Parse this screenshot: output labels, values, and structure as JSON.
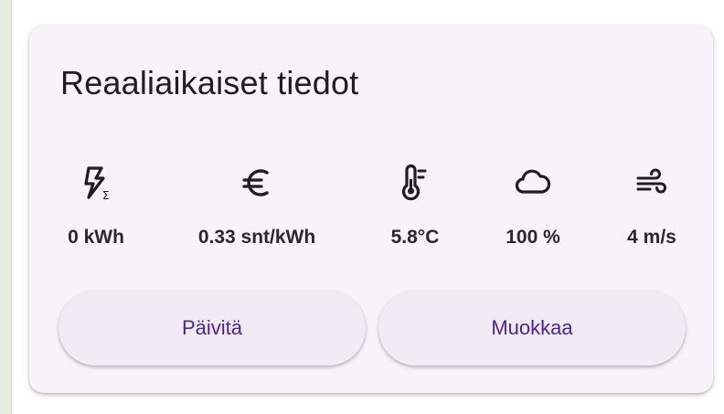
{
  "card": {
    "title": "Reaaliaikaiset tiedot"
  },
  "metrics": [
    {
      "icon": "lightning-sum-icon",
      "value": "0 kWh"
    },
    {
      "icon": "euro-icon",
      "value": "0.33 snt/kWh"
    },
    {
      "icon": "thermometer-icon",
      "value": "5.8°C"
    },
    {
      "icon": "cloud-icon",
      "value": "100 %"
    },
    {
      "icon": "wind-icon",
      "value": "4 m/s"
    }
  ],
  "actions": {
    "refresh_label": "Päivitä",
    "edit_label": "Muokkaa"
  },
  "colors": {
    "card_background": "#f8f3fa",
    "button_background": "#f1ebf5",
    "button_text": "#4a1fa8",
    "text": "#1f1d22"
  }
}
